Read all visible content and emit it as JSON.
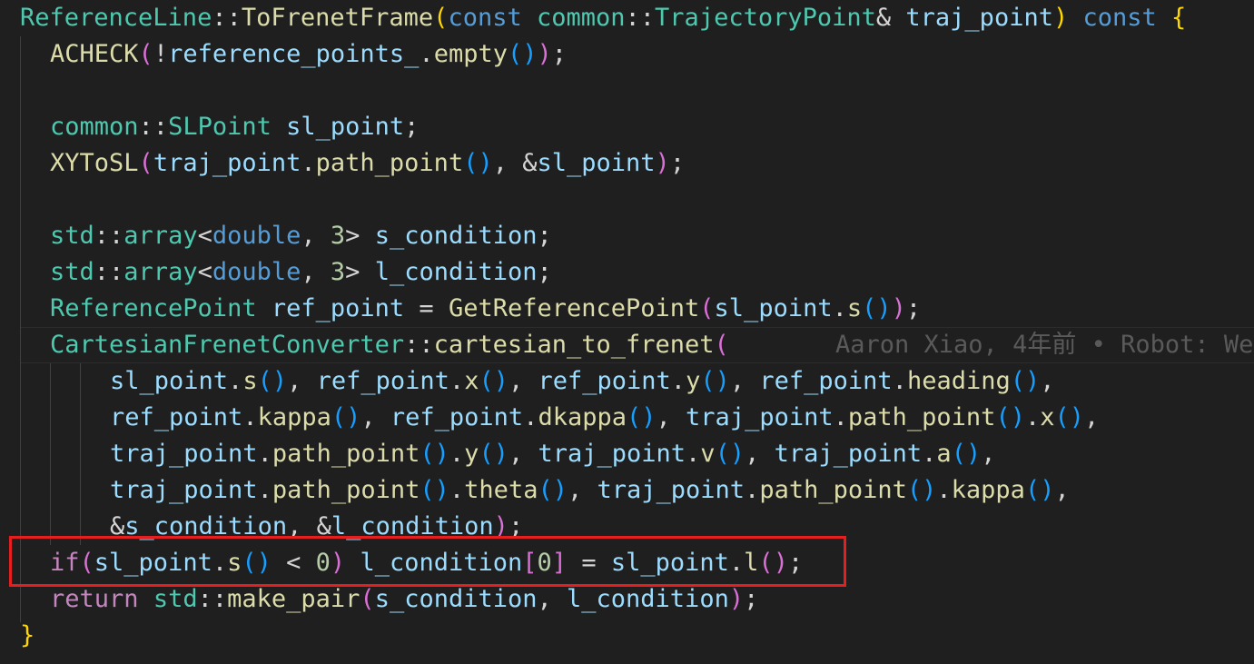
{
  "editor": {
    "blame_annotation": "Aaron Xiao, 4年前 • Robot: We",
    "lines": [
      [
        [
          "t",
          "ReferenceLine"
        ],
        [
          "p",
          "::"
        ],
        [
          "f",
          "ToFrenetFrame"
        ],
        [
          "b1",
          "("
        ],
        [
          "k",
          "const"
        ],
        [
          "p",
          " "
        ],
        [
          "t",
          "common"
        ],
        [
          "p",
          "::"
        ],
        [
          "t",
          "TrajectoryPoint"
        ],
        [
          "p",
          "& "
        ],
        [
          "v",
          "traj_point"
        ],
        [
          "b1",
          ")"
        ],
        [
          "p",
          " "
        ],
        [
          "k",
          "const"
        ],
        [
          "p",
          " "
        ],
        [
          "b1",
          "{"
        ]
      ],
      [
        [
          "f",
          "ACHECK"
        ],
        [
          "b2",
          "("
        ],
        [
          "p",
          "!"
        ],
        [
          "v",
          "reference_points_"
        ],
        [
          "p",
          "."
        ],
        [
          "f",
          "empty"
        ],
        [
          "b3",
          "()"
        ],
        [
          "b2",
          ")"
        ],
        [
          "p",
          ";"
        ]
      ],
      [],
      [
        [
          "t",
          "common"
        ],
        [
          "p",
          "::"
        ],
        [
          "t",
          "SLPoint"
        ],
        [
          "p",
          " "
        ],
        [
          "v",
          "sl_point"
        ],
        [
          "p",
          ";"
        ]
      ],
      [
        [
          "f",
          "XYToSL"
        ],
        [
          "b2",
          "("
        ],
        [
          "v",
          "traj_point"
        ],
        [
          "p",
          "."
        ],
        [
          "f",
          "path_point"
        ],
        [
          "b3",
          "()"
        ],
        [
          "p",
          ", &"
        ],
        [
          "v",
          "sl_point"
        ],
        [
          "b2",
          ")"
        ],
        [
          "p",
          ";"
        ]
      ],
      [],
      [
        [
          "t",
          "std"
        ],
        [
          "p",
          "::"
        ],
        [
          "t",
          "array"
        ],
        [
          "p",
          "<"
        ],
        [
          "k",
          "double"
        ],
        [
          "p",
          ", "
        ],
        [
          "n",
          "3"
        ],
        [
          "p",
          "> "
        ],
        [
          "v",
          "s_condition"
        ],
        [
          "p",
          ";"
        ]
      ],
      [
        [
          "t",
          "std"
        ],
        [
          "p",
          "::"
        ],
        [
          "t",
          "array"
        ],
        [
          "p",
          "<"
        ],
        [
          "k",
          "double"
        ],
        [
          "p",
          ", "
        ],
        [
          "n",
          "3"
        ],
        [
          "p",
          "> "
        ],
        [
          "v",
          "l_condition"
        ],
        [
          "p",
          ";"
        ]
      ],
      [
        [
          "t",
          "ReferencePoint"
        ],
        [
          "p",
          " "
        ],
        [
          "v",
          "ref_point"
        ],
        [
          "p",
          " = "
        ],
        [
          "f",
          "GetReferencePoint"
        ],
        [
          "b2",
          "("
        ],
        [
          "v",
          "sl_point"
        ],
        [
          "p",
          "."
        ],
        [
          "f",
          "s"
        ],
        [
          "b3",
          "()"
        ],
        [
          "b2",
          ")"
        ],
        [
          "p",
          ";"
        ]
      ],
      [
        [
          "t",
          "CartesianFrenetConverter"
        ],
        [
          "p",
          "::"
        ],
        [
          "f",
          "cartesian_to_frenet"
        ],
        [
          "b2",
          "("
        ]
      ],
      [
        [
          "v",
          "sl_point"
        ],
        [
          "p",
          "."
        ],
        [
          "f",
          "s"
        ],
        [
          "b3",
          "()"
        ],
        [
          "p",
          ", "
        ],
        [
          "v",
          "ref_point"
        ],
        [
          "p",
          "."
        ],
        [
          "f",
          "x"
        ],
        [
          "b3",
          "()"
        ],
        [
          "p",
          ", "
        ],
        [
          "v",
          "ref_point"
        ],
        [
          "p",
          "."
        ],
        [
          "f",
          "y"
        ],
        [
          "b3",
          "()"
        ],
        [
          "p",
          ", "
        ],
        [
          "v",
          "ref_point"
        ],
        [
          "p",
          "."
        ],
        [
          "f",
          "heading"
        ],
        [
          "b3",
          "()"
        ],
        [
          "p",
          ","
        ]
      ],
      [
        [
          "v",
          "ref_point"
        ],
        [
          "p",
          "."
        ],
        [
          "f",
          "kappa"
        ],
        [
          "b3",
          "()"
        ],
        [
          "p",
          ", "
        ],
        [
          "v",
          "ref_point"
        ],
        [
          "p",
          "."
        ],
        [
          "f",
          "dkappa"
        ],
        [
          "b3",
          "()"
        ],
        [
          "p",
          ", "
        ],
        [
          "v",
          "traj_point"
        ],
        [
          "p",
          "."
        ],
        [
          "f",
          "path_point"
        ],
        [
          "b3",
          "()"
        ],
        [
          "p",
          "."
        ],
        [
          "f",
          "x"
        ],
        [
          "b3",
          "()"
        ],
        [
          "p",
          ","
        ]
      ],
      [
        [
          "v",
          "traj_point"
        ],
        [
          "p",
          "."
        ],
        [
          "f",
          "path_point"
        ],
        [
          "b3",
          "()"
        ],
        [
          "p",
          "."
        ],
        [
          "f",
          "y"
        ],
        [
          "b3",
          "()"
        ],
        [
          "p",
          ", "
        ],
        [
          "v",
          "traj_point"
        ],
        [
          "p",
          "."
        ],
        [
          "f",
          "v"
        ],
        [
          "b3",
          "()"
        ],
        [
          "p",
          ", "
        ],
        [
          "v",
          "traj_point"
        ],
        [
          "p",
          "."
        ],
        [
          "f",
          "a"
        ],
        [
          "b3",
          "()"
        ],
        [
          "p",
          ","
        ]
      ],
      [
        [
          "v",
          "traj_point"
        ],
        [
          "p",
          "."
        ],
        [
          "f",
          "path_point"
        ],
        [
          "b3",
          "()"
        ],
        [
          "p",
          "."
        ],
        [
          "f",
          "theta"
        ],
        [
          "b3",
          "()"
        ],
        [
          "p",
          ", "
        ],
        [
          "v",
          "traj_point"
        ],
        [
          "p",
          "."
        ],
        [
          "f",
          "path_point"
        ],
        [
          "b3",
          "()"
        ],
        [
          "p",
          "."
        ],
        [
          "f",
          "kappa"
        ],
        [
          "b3",
          "()"
        ],
        [
          "p",
          ","
        ]
      ],
      [
        [
          "p",
          "&"
        ],
        [
          "v",
          "s_condition"
        ],
        [
          "p",
          ", &"
        ],
        [
          "v",
          "l_condition"
        ],
        [
          "b2",
          ")"
        ],
        [
          "p",
          ";"
        ]
      ],
      [
        [
          "c",
          "if"
        ],
        [
          "b2",
          "("
        ],
        [
          "v",
          "sl_point"
        ],
        [
          "p",
          "."
        ],
        [
          "f",
          "s"
        ],
        [
          "b3",
          "()"
        ],
        [
          "p",
          " < "
        ],
        [
          "n",
          "0"
        ],
        [
          "b2",
          ")"
        ],
        [
          "p",
          " "
        ],
        [
          "v",
          "l_condition"
        ],
        [
          "b2",
          "["
        ],
        [
          "n",
          "0"
        ],
        [
          "b2",
          "]"
        ],
        [
          "p",
          " = "
        ],
        [
          "v",
          "sl_point"
        ],
        [
          "p",
          "."
        ],
        [
          "f",
          "l"
        ],
        [
          "b2",
          "("
        ],
        [
          "b2",
          ")"
        ],
        [
          "p",
          ";"
        ]
      ],
      [
        [
          "c",
          "return"
        ],
        [
          "p",
          " "
        ],
        [
          "t",
          "std"
        ],
        [
          "p",
          "::"
        ],
        [
          "f",
          "make_pair"
        ],
        [
          "b2",
          "("
        ],
        [
          "v",
          "s_condition"
        ],
        [
          "p",
          ", "
        ],
        [
          "v",
          "l_condition"
        ],
        [
          "b2",
          ")"
        ],
        [
          "p",
          ";"
        ]
      ],
      [
        [
          "b1",
          "}"
        ]
      ]
    ]
  }
}
